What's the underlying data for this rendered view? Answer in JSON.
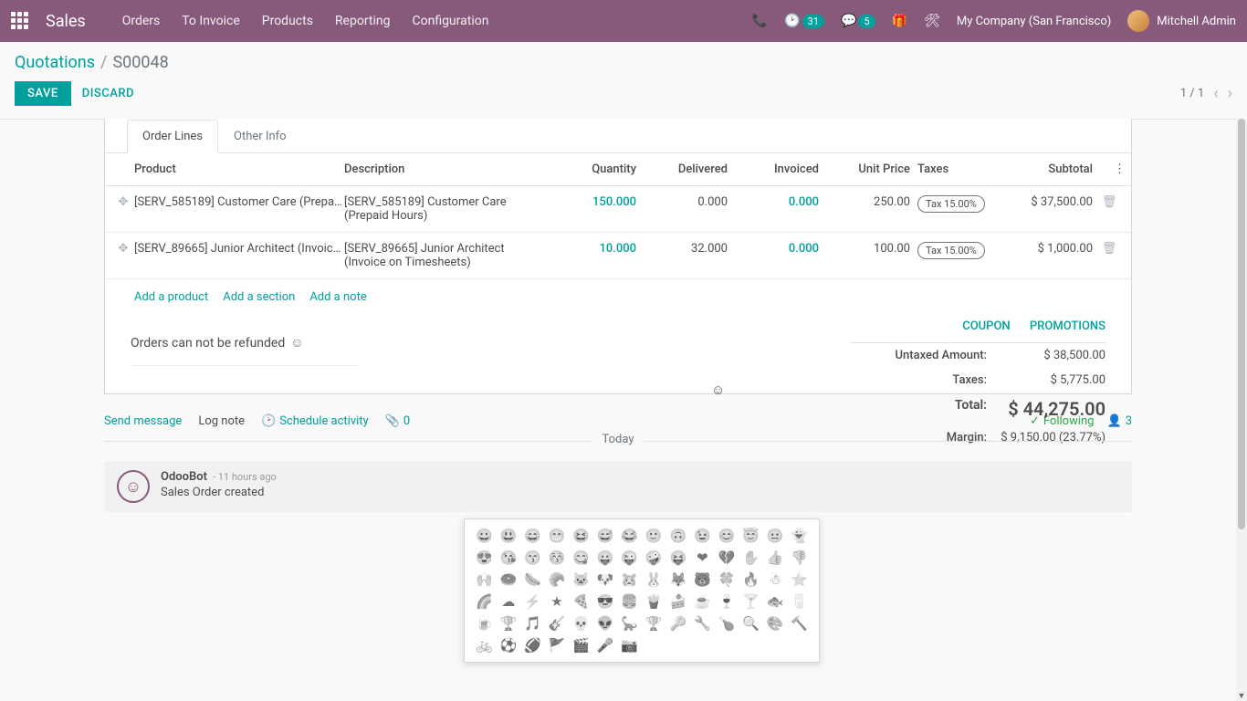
{
  "nav": {
    "brand": "Sales",
    "items": [
      "Orders",
      "To Invoice",
      "Products",
      "Reporting",
      "Configuration"
    ],
    "activity_count": "31",
    "msg_count": "5",
    "company": "My Company (San Francisco)",
    "user": "Mitchell Admin"
  },
  "crumbs": {
    "root": "Quotations",
    "here": "S00048"
  },
  "actions": {
    "save": "SAVE",
    "discard": "DISCARD",
    "pager": "1 / 1"
  },
  "tabs": {
    "lines": "Order Lines",
    "other": "Other Info"
  },
  "columns": {
    "product": "Product",
    "description": "Description",
    "quantity": "Quantity",
    "delivered": "Delivered",
    "invoiced": "Invoiced",
    "unit_price": "Unit Price",
    "taxes": "Taxes",
    "subtotal": "Subtotal"
  },
  "rows": [
    {
      "product": "[SERV_585189] Customer Care (Prepai...",
      "description": "[SERV_585189] Customer Care (Prepaid Hours)",
      "quantity": "150.000",
      "delivered": "0.000",
      "invoiced": "0.000",
      "unit_price": "250.00",
      "tax": "Tax 15.00%",
      "subtotal": "$ 37,500.00"
    },
    {
      "product": "[SERV_89665] Junior Architect (Invoice...",
      "description": "[SERV_89665] Junior Architect (Invoice on Timesheets)",
      "quantity": "10.000",
      "delivered": "32.000",
      "invoiced": "0.000",
      "unit_price": "100.00",
      "tax": "Tax 15.00%",
      "subtotal": "$ 1,000.00"
    }
  ],
  "adders": {
    "product": "Add a product",
    "section": "Add a section",
    "note": "Add a note"
  },
  "note_text": "Orders can not be refunded",
  "summary": {
    "coupon": "COUPON",
    "promo": "PROMOTIONS",
    "untaxed_l": "Untaxed Amount:",
    "untaxed_v": "$ 38,500.00",
    "taxes_l": "Taxes:",
    "taxes_v": "$ 5,775.00",
    "total_l": "Total:",
    "total_v": "$ 44,275.00",
    "margin_l": "Margin:",
    "margin_v": "$ 9,150.00 (23.77%)"
  },
  "chatter": {
    "send": "Send message",
    "log": "Log note",
    "schedule": "Schedule activity",
    "attach": "0",
    "following": "Following",
    "followers": "3",
    "day": "Today",
    "author": "OdooBot",
    "time": "- 11 hours ago",
    "body": "Sales Order created"
  },
  "emojis": [
    "😀",
    "😃",
    "😄",
    "😁",
    "😆",
    "😅",
    "😂",
    "🙂",
    "🙃",
    "😉",
    "😊",
    "😇",
    "😐",
    "👻",
    "😍",
    "😘",
    "😙",
    "😚",
    "😋",
    "😛",
    "😜",
    "🤪",
    "😝",
    "❤",
    "💔",
    "✋",
    "👍",
    "👎",
    "🙌",
    "🍩",
    "🌭",
    "🥐",
    "🐱",
    "🐶",
    "🐹",
    "🐰",
    "🦊",
    "🐻",
    "🍀",
    "🔥",
    "☃",
    "⭐",
    "🌈",
    "☁",
    "⚡",
    "★",
    "🍕",
    "😎",
    "🍔",
    "🍟",
    "🍰",
    "☕",
    "🍷",
    "🍸",
    "🐟",
    "🥛",
    "🍺",
    "🏆",
    "🎵",
    "🎸",
    "💀",
    "👽",
    "🦕",
    "🏆",
    "🔑",
    "🔧",
    "🍗",
    "🔍",
    "🎨",
    "🔨",
    "🚲",
    "⚽",
    "🏈",
    "🚩",
    "🎬",
    "🎤",
    "📷"
  ]
}
